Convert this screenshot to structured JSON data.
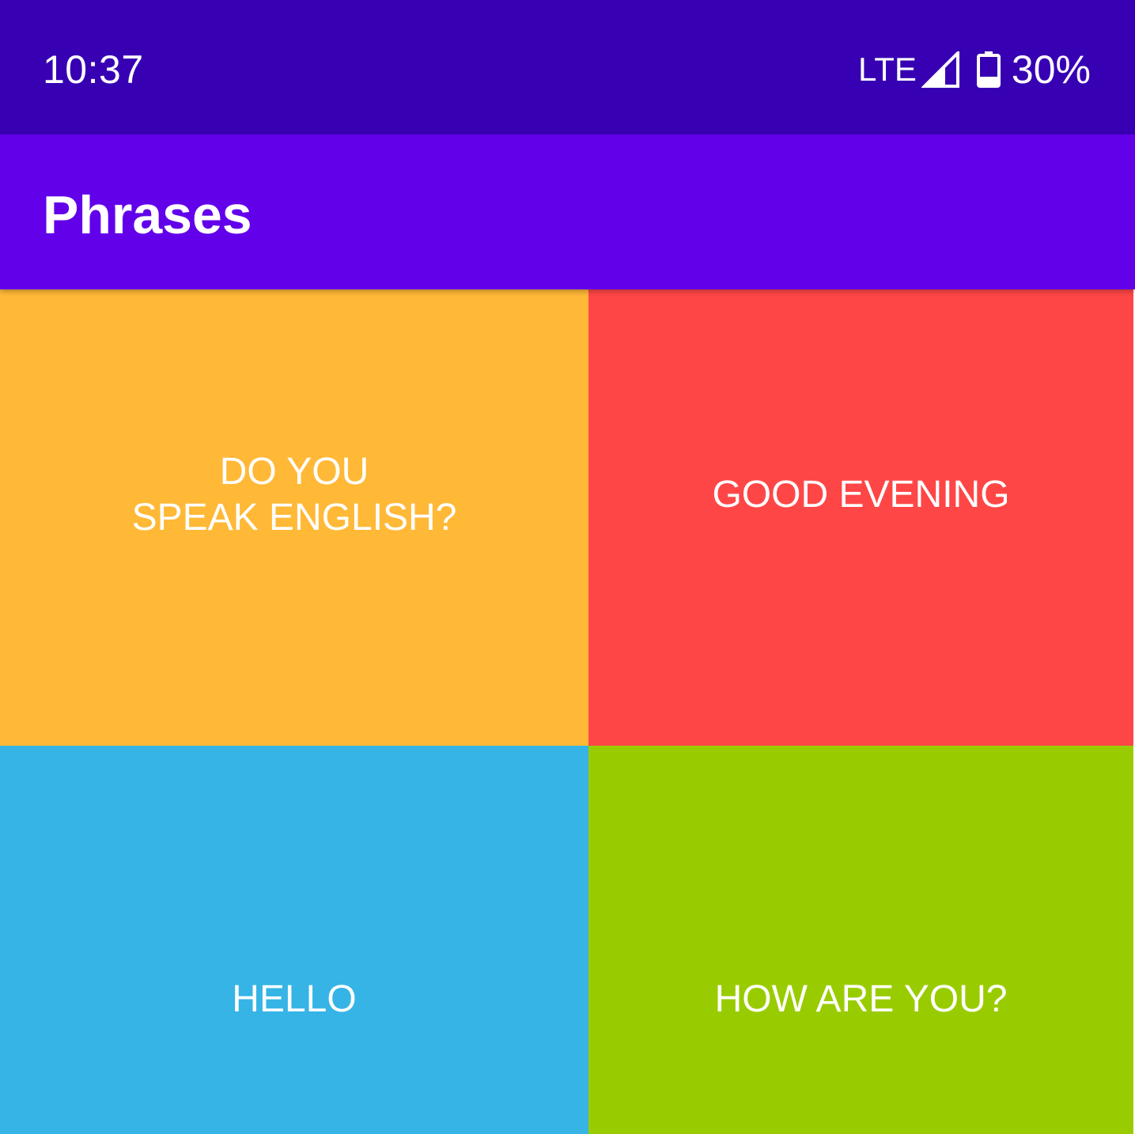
{
  "status_bar": {
    "time": "10:37",
    "network": "LTE",
    "signal_icon": "signal-strength-icon",
    "battery_icon": "battery-icon",
    "battery_percent": "30%",
    "battery_level": 0.3,
    "background_color": "#3700b3"
  },
  "app_bar": {
    "title": "Phrases",
    "background_color": "#6200ea"
  },
  "phrases": [
    {
      "label": "DO YOU\nSPEAK ENGLISH?",
      "color": "#ffb937"
    },
    {
      "label": "GOOD EVENING",
      "color": "#ff4646"
    },
    {
      "label": "HELLO",
      "color": "#35b4e5"
    },
    {
      "label": "HOW ARE YOU?",
      "color": "#99cc00"
    }
  ]
}
